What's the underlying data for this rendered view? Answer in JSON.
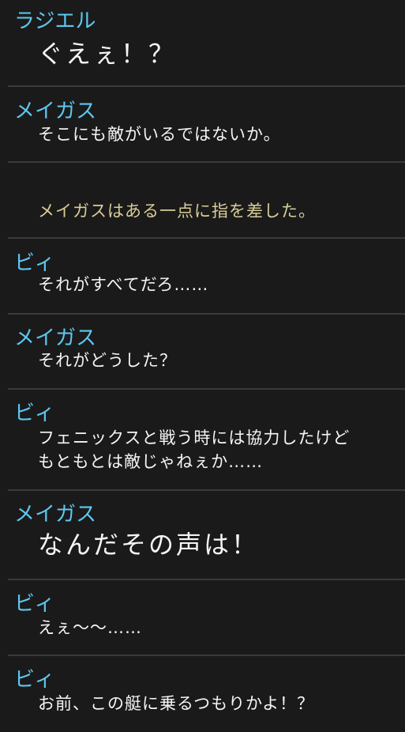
{
  "log": {
    "entries": [
      {
        "speaker": "ラジエル",
        "lines": [
          "ぐえぇ！？"
        ],
        "style": "big"
      },
      {
        "speaker": "メイガス",
        "lines": [
          "そこにも敵がいるではないか。"
        ],
        "style": "normal"
      },
      {
        "speaker": "",
        "lines": [
          "メイガスはある一点に指を差した。"
        ],
        "style": "narration"
      },
      {
        "speaker": "ビィ",
        "lines": [
          "それがすべてだろ……"
        ],
        "style": "normal"
      },
      {
        "speaker": "メイガス",
        "lines": [
          "それがどうした？"
        ],
        "style": "normal"
      },
      {
        "speaker": "ビィ",
        "lines": [
          "フェニックスと戦う時には協力したけど",
          "もともとは敵じゃねぇか……"
        ],
        "style": "normal"
      },
      {
        "speaker": "メイガス",
        "lines": [
          "なんだその声は！"
        ],
        "style": "big"
      },
      {
        "speaker": "ビィ",
        "lines": [
          "えぇ～～……"
        ],
        "style": "normal"
      },
      {
        "speaker": "ビィ",
        "lines": [
          "お前、この艇に乗るつもりかよ！？"
        ],
        "style": "normal"
      }
    ]
  }
}
